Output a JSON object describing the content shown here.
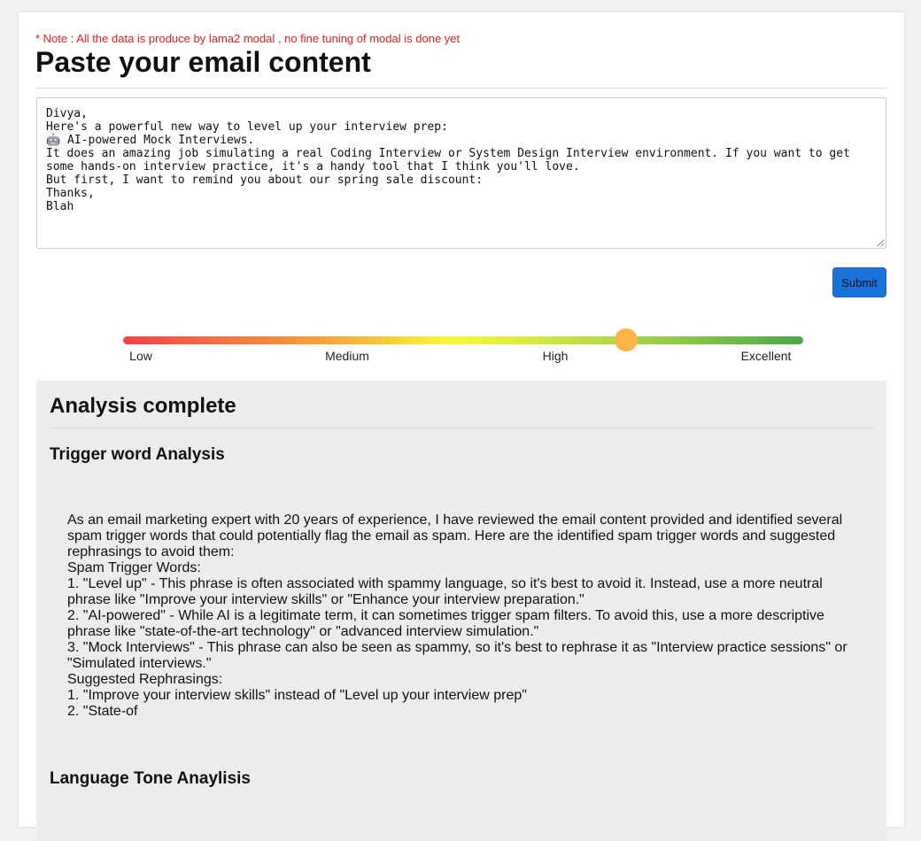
{
  "note": "* Note : All the data is produce by lama2 modal , no fine tuning of modal is done yet",
  "title": "Paste your email content",
  "email": {
    "content": "Divya,\nHere's a powerful new way to level up your interview prep:\n🤖 AI-powered Mock Interviews.\nIt does an amazing job simulating a real Coding Interview or System Design Interview environment. If you want to get some hands-on interview practice, it's a handy tool that I think you'll love.\nBut first, I want to remind you about our spring sale discount:\nThanks,\nBlah"
  },
  "submit_label": "Submit",
  "meter": {
    "labels": [
      "Low",
      "Medium",
      "High",
      "Excellent"
    ],
    "value_fraction": 0.74,
    "knob_color": "#fbb549"
  },
  "analysis": {
    "title": "Analysis complete",
    "trigger_heading": "Trigger word Analysis",
    "trigger_lines": [
      "As an email marketing expert with 20 years of experience, I have reviewed the email content provided and identified several spam trigger words that could potentially flag the email as spam. Here are the identified spam trigger words and suggested rephrasings to avoid them:",
      "Spam Trigger Words:",
      "1. \"Level up\" - This phrase is often associated with spammy language, so it's best to avoid it. Instead, use a more neutral phrase like \"Improve your interview skills\" or \"Enhance your interview preparation.\"",
      "2. \"AI-powered\" - While AI is a legitimate term, it can sometimes trigger spam filters. To avoid this, use a more descriptive phrase like \"state-of-the-art technology\" or \"advanced interview simulation.\"",
      "3. \"Mock Interviews\" - This phrase can also be seen as spammy, so it's best to rephrase it as \"Interview practice sessions\" or \"Simulated interviews.\"",
      "Suggested Rephrasings:",
      "1. \"Improve your interview skills\" instead of \"Level up your interview prep\"",
      "2. \"State-of"
    ],
    "tone_heading": "Language Tone Anaylisis"
  }
}
